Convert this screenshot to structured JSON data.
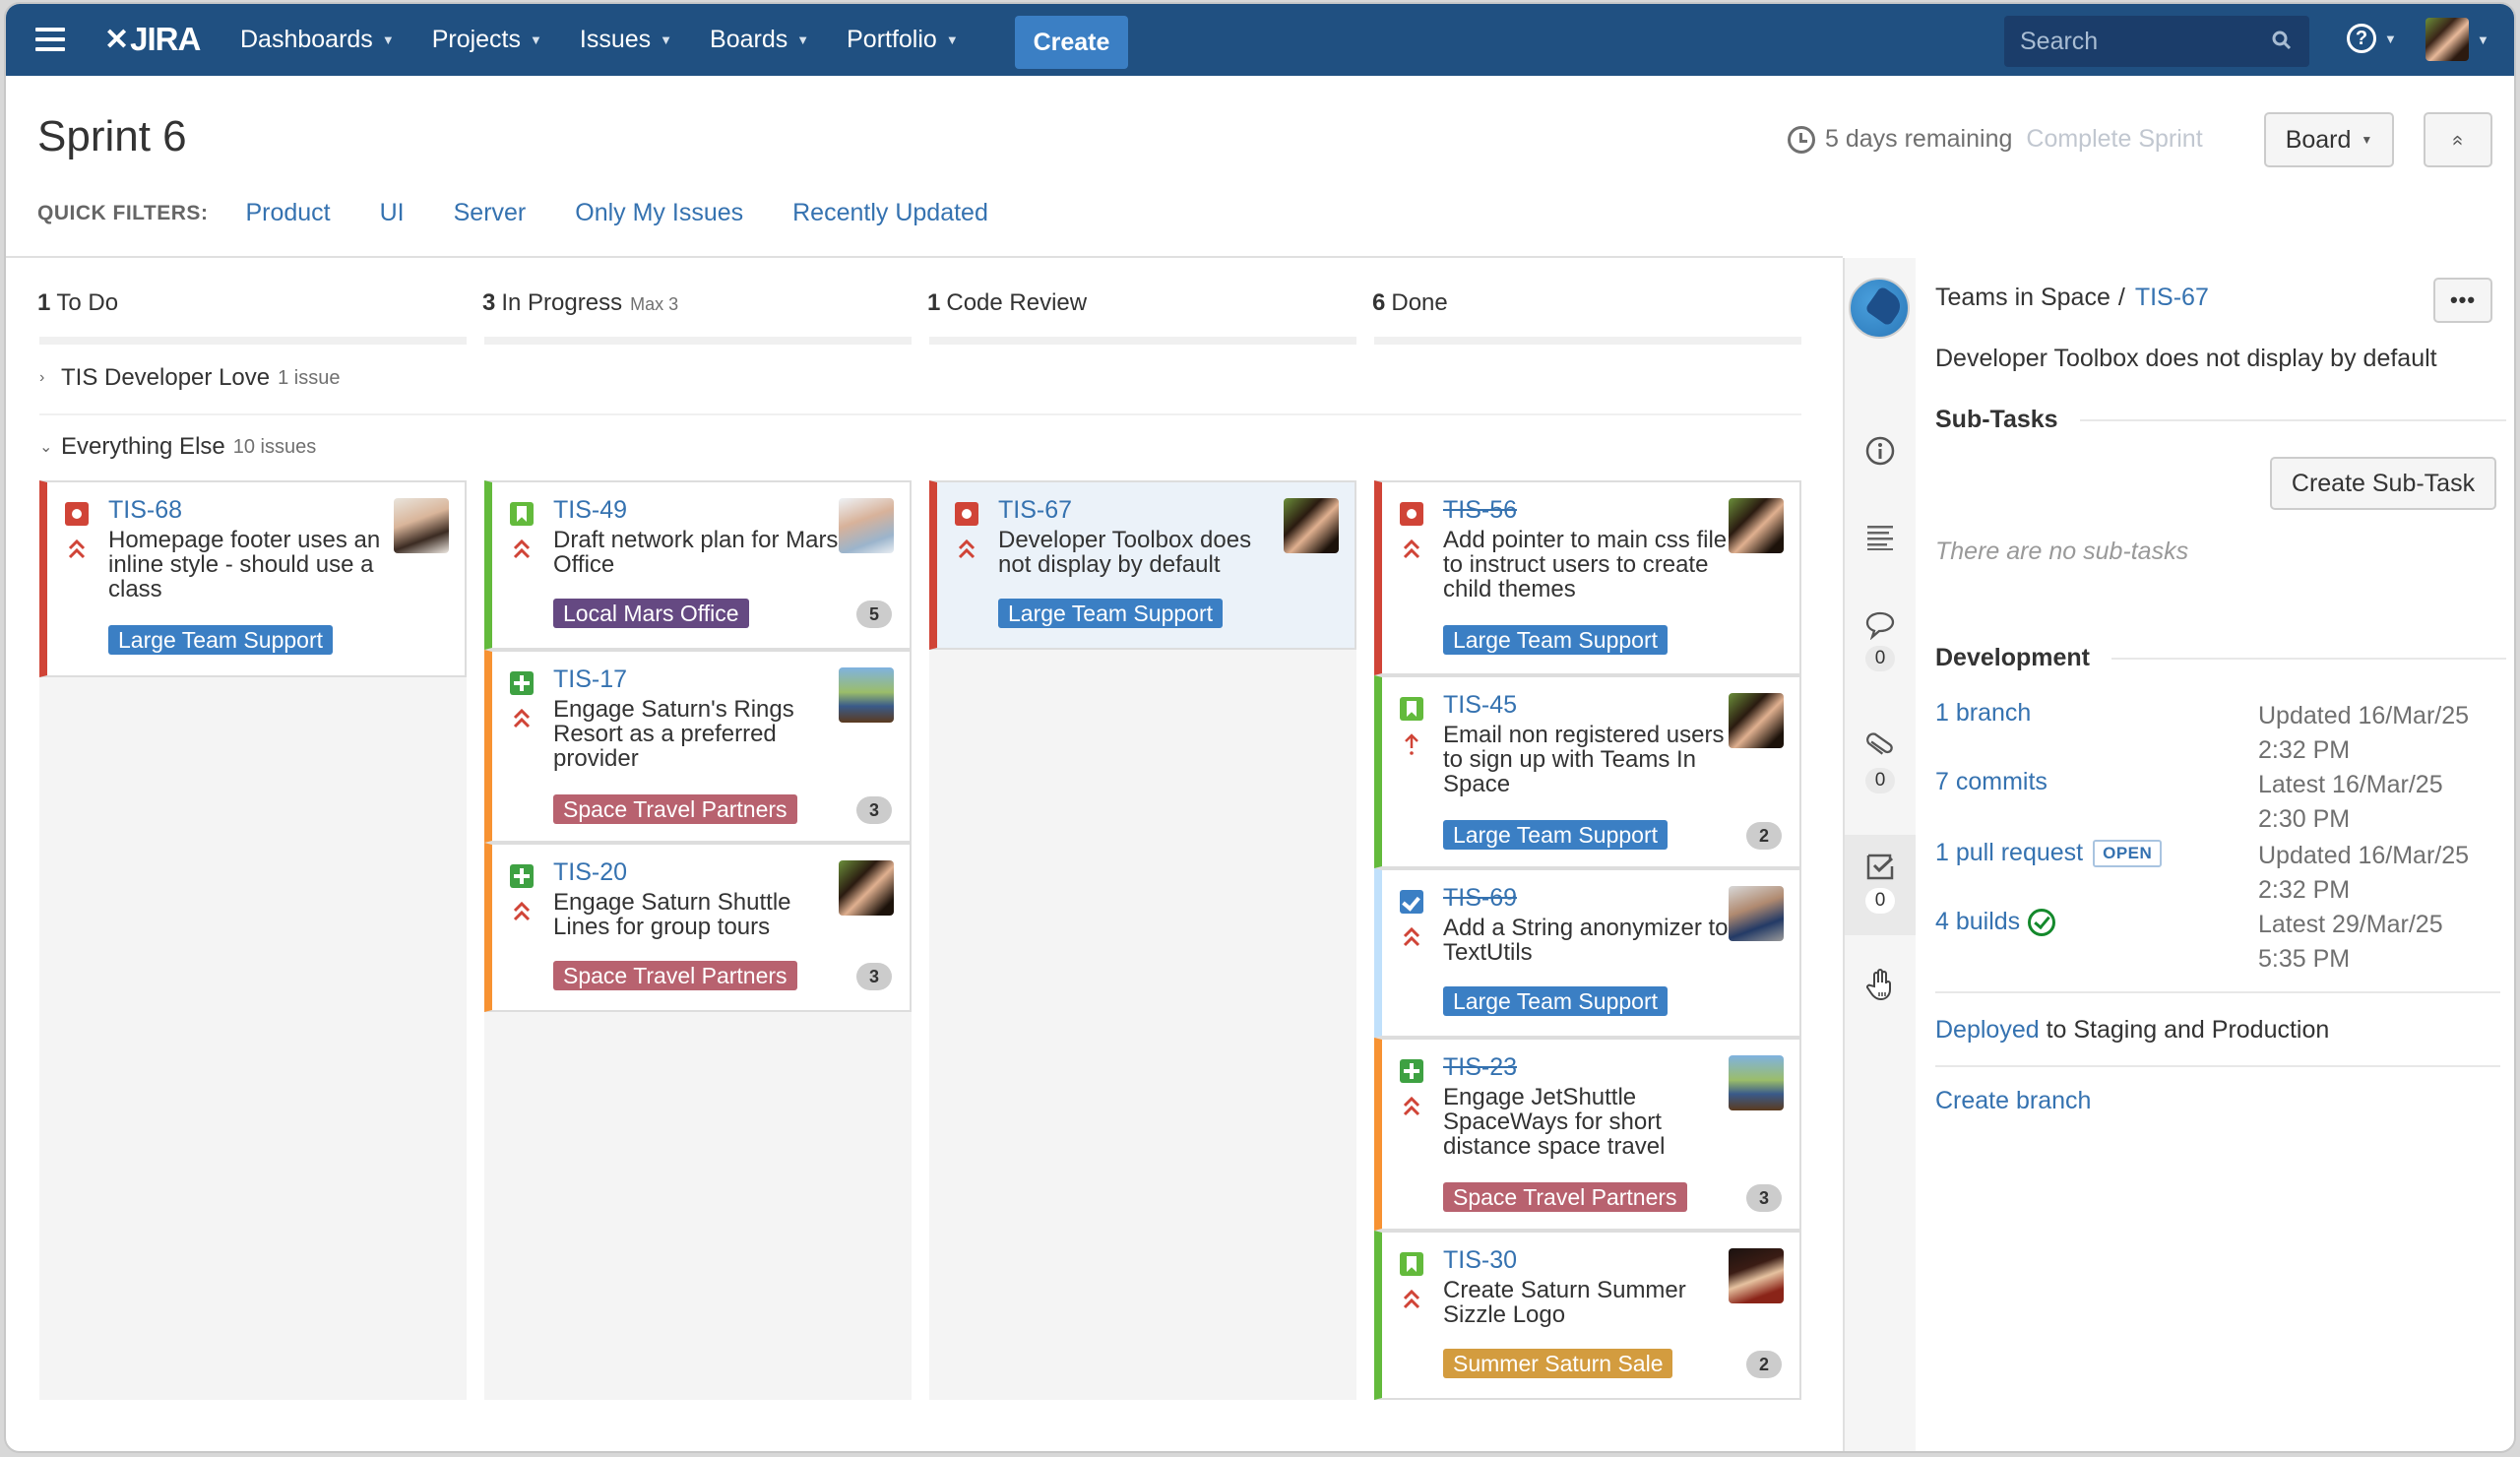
{
  "nav": {
    "logo": "JIRA",
    "items": [
      {
        "label": "Dashboards"
      },
      {
        "label": "Projects"
      },
      {
        "label": "Issues"
      },
      {
        "label": "Boards"
      },
      {
        "label": "Portfolio"
      }
    ],
    "create_label": "Create",
    "search_placeholder": "Search",
    "help_glyph": "?"
  },
  "header": {
    "title": "Sprint 6",
    "remaining": "5 days remaining",
    "complete_sprint": "Complete Sprint",
    "board_button": "Board",
    "collapse_glyph": "«",
    "quick_filters_label": "QUICK FILTERS:",
    "quick_filters": [
      "Product",
      "UI",
      "Server",
      "Only My Issues",
      "Recently Updated"
    ]
  },
  "columns": [
    {
      "count": "1",
      "name": "To Do",
      "note": ""
    },
    {
      "count": "3",
      "name": "In Progress",
      "note": "Max 3"
    },
    {
      "count": "1",
      "name": "Code Review",
      "note": ""
    },
    {
      "count": "6",
      "name": "Done",
      "note": ""
    }
  ],
  "swimlanes": [
    {
      "name": "TIS Developer Love",
      "count": "1 issue",
      "chevron": "›"
    },
    {
      "name": "Everything Else",
      "count": "10 issues",
      "chevron": "⌄"
    }
  ],
  "colors": {
    "red": "#d04437",
    "green": "#63ba3c",
    "orange": "#f79232",
    "lightblue": "#c0e0fb",
    "epic_blue": "#3b7fc4",
    "epic_purple": "#654982",
    "epic_rose": "#b8626f",
    "epic_gold": "#d39c3f"
  },
  "cards": [
    {
      "key": "TIS-68",
      "type": "bug",
      "priority": "highest",
      "summary": "Homepage footer uses an inline style - should use a class",
      "epic": "Large Team Support",
      "epic_color": "#3b7fc4",
      "estimate": "",
      "done": false,
      "bar": "#d04437",
      "avatar": "a1"
    },
    {
      "key": "TIS-49",
      "type": "story",
      "priority": "highest",
      "summary": "Draft network plan for Mars Office",
      "epic": "Local Mars Office",
      "epic_color": "#654982",
      "estimate": "5",
      "done": false,
      "bar": "#63ba3c",
      "avatar": "a2"
    },
    {
      "key": "TIS-17",
      "type": "new-feature",
      "priority": "highest",
      "summary": "Engage Saturn's Rings Resort as a preferred provider",
      "epic": "Space Travel Partners",
      "epic_color": "#b8626f",
      "estimate": "3",
      "done": false,
      "bar": "#f79232",
      "avatar": "a3"
    },
    {
      "key": "TIS-20",
      "type": "new-feature",
      "priority": "highest",
      "summary": "Engage Saturn Shuttle Lines for group tours",
      "epic": "Space Travel Partners",
      "epic_color": "#b8626f",
      "estimate": "3",
      "done": false,
      "bar": "#f79232",
      "avatar": "a4"
    },
    {
      "key": "TIS-67",
      "type": "bug",
      "priority": "highest",
      "summary": "Developer Toolbox does not display by default",
      "epic": "Large Team Support",
      "epic_color": "#3b7fc4",
      "estimate": "",
      "done": false,
      "bar": "#d04437",
      "avatar": "a4"
    },
    {
      "key": "TIS-56",
      "type": "bug",
      "priority": "highest",
      "summary": "Add pointer to main css file to instruct users to create child themes",
      "epic": "Large Team Support",
      "epic_color": "#3b7fc4",
      "estimate": "",
      "done": true,
      "bar": "#d04437",
      "avatar": "a4"
    },
    {
      "key": "TIS-45",
      "type": "story",
      "priority": "high",
      "summary": "Email non registered users to sign up with Teams In Space",
      "epic": "Large Team Support",
      "epic_color": "#3b7fc4",
      "estimate": "2",
      "done": false,
      "bar": "#63ba3c",
      "avatar": "a4"
    },
    {
      "key": "TIS-69",
      "type": "task",
      "priority": "highest",
      "summary": "Add a String anonymizer to TextUtils",
      "epic": "Large Team Support",
      "epic_color": "#3b7fc4",
      "estimate": "",
      "done": true,
      "bar": "#c0e0fb",
      "avatar": "a5"
    },
    {
      "key": "TIS-23",
      "type": "new-feature",
      "priority": "highest",
      "summary": "Engage JetShuttle SpaceWays for short distance space travel",
      "epic": "Space Travel Partners",
      "epic_color": "#b8626f",
      "estimate": "3",
      "done": true,
      "bar": "#f79232",
      "avatar": "a3"
    },
    {
      "key": "TIS-30",
      "type": "story",
      "priority": "highest",
      "summary": "Create Saturn Summer Sizzle Logo",
      "epic": "Summer Saturn Sale",
      "epic_color": "#d39c3f",
      "estimate": "2",
      "done": false,
      "bar": "#63ba3c",
      "avatar": "a6"
    }
  ],
  "detail": {
    "project": "Teams in Space",
    "separator": "/",
    "key": "TIS-67",
    "more_glyph": "•••",
    "summary": "Developer Toolbox does not display by default",
    "subtasks_title": "Sub-Tasks",
    "create_subtask": "Create Sub-Task",
    "no_subtasks": "There are no sub-tasks",
    "development_title": "Development",
    "dev": [
      {
        "link": "1 branch",
        "meta1": "Updated 16/Mar/25",
        "meta2": "2:32 PM"
      },
      {
        "link": "7 commits",
        "meta1": "Latest 16/Mar/25",
        "meta2": "2:30 PM"
      },
      {
        "link": "1 pull request",
        "badge": "OPEN",
        "meta1": "Updated 16/Mar/25",
        "meta2": "2:32 PM"
      },
      {
        "link": "4 builds",
        "meta1": "Latest 29/Mar/25",
        "meta2": "5:35 PM"
      }
    ],
    "deployed_link": "Deployed",
    "deployed_rest": " to Staging and Production",
    "create_branch": "Create branch",
    "strip": {
      "comments": "0",
      "attachments": "0",
      "checklist": "0"
    }
  }
}
